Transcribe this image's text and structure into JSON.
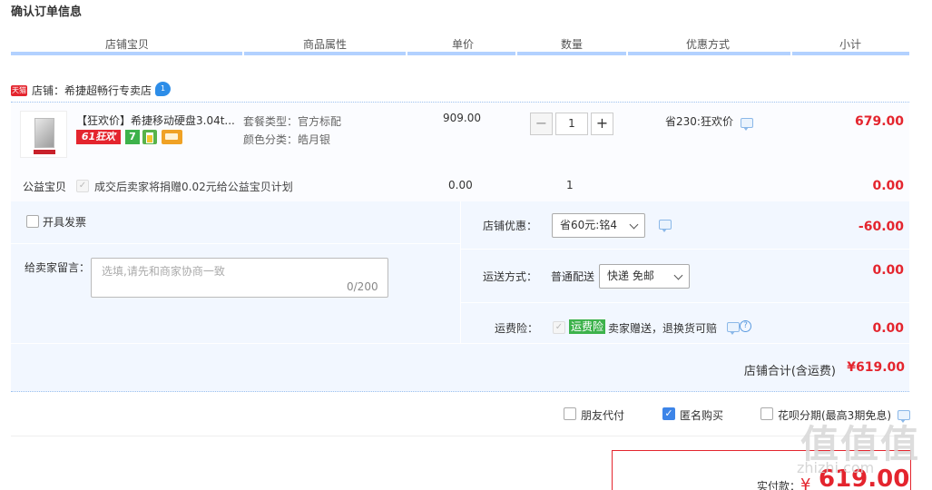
{
  "title": "确认订单信息",
  "columns": [
    "店铺宝贝",
    "商品属性",
    "单价",
    "数量",
    "优惠方式",
    "小计"
  ],
  "shop": {
    "badge": "天猫",
    "name": "店铺：希捷超畅行专卖店",
    "ww_badge": "1"
  },
  "item": {
    "title": "【狂欢价】希捷移动硬盘3.04t...",
    "badge_61": "61狂欢",
    "badge_7": "7",
    "attr_package": "套餐类型：官方标配",
    "attr_color": "颜色分类：皓月银",
    "price": "909.00",
    "qty": "1",
    "qty_minus": "−",
    "qty_plus": "+",
    "promo": "省230:狂欢价",
    "subtotal": "679.00"
  },
  "charity": {
    "label": "公益宝贝",
    "text": "成交后卖家将捐赠0.02元给公益宝贝计划",
    "price": "0.00",
    "qty": "1",
    "subtotal": "0.00"
  },
  "options": {
    "invoice_label": "开具发票",
    "message_label": "给卖家留言：",
    "message_placeholder": "选填,请先和商家协商一致",
    "message_count": "0/200",
    "shop_discount_label": "店铺优惠：",
    "shop_discount_value": "省60元:铭4",
    "shop_discount_amount": "-60.00",
    "shipping_label": "运送方式：",
    "shipping_type": "普通配送",
    "shipping_value": "快递 免邮",
    "shipping_amount": "0.00",
    "insurance_label": "运费险：",
    "insurance_tag": "运费险",
    "insurance_text": "卖家赠送，退换货可赔",
    "insurance_amount": "0.00"
  },
  "total": {
    "label": "店铺合计(含运费)",
    "value": "¥619.00"
  },
  "pay_options": {
    "friend_pay": "朋友代付",
    "anonymous": "匿名购买",
    "huabei": "花呗分期(最高3期免息)"
  },
  "payment": {
    "label": "实付款：",
    "currency": "¥",
    "amount": "619.00"
  },
  "watermark": {
    "text": "值值值",
    "url": "zhizhi.com"
  },
  "colors": {
    "accent_red": "#e4252e",
    "header_line": "#b2d1ff",
    "option_bg": "#f2f7ff"
  }
}
